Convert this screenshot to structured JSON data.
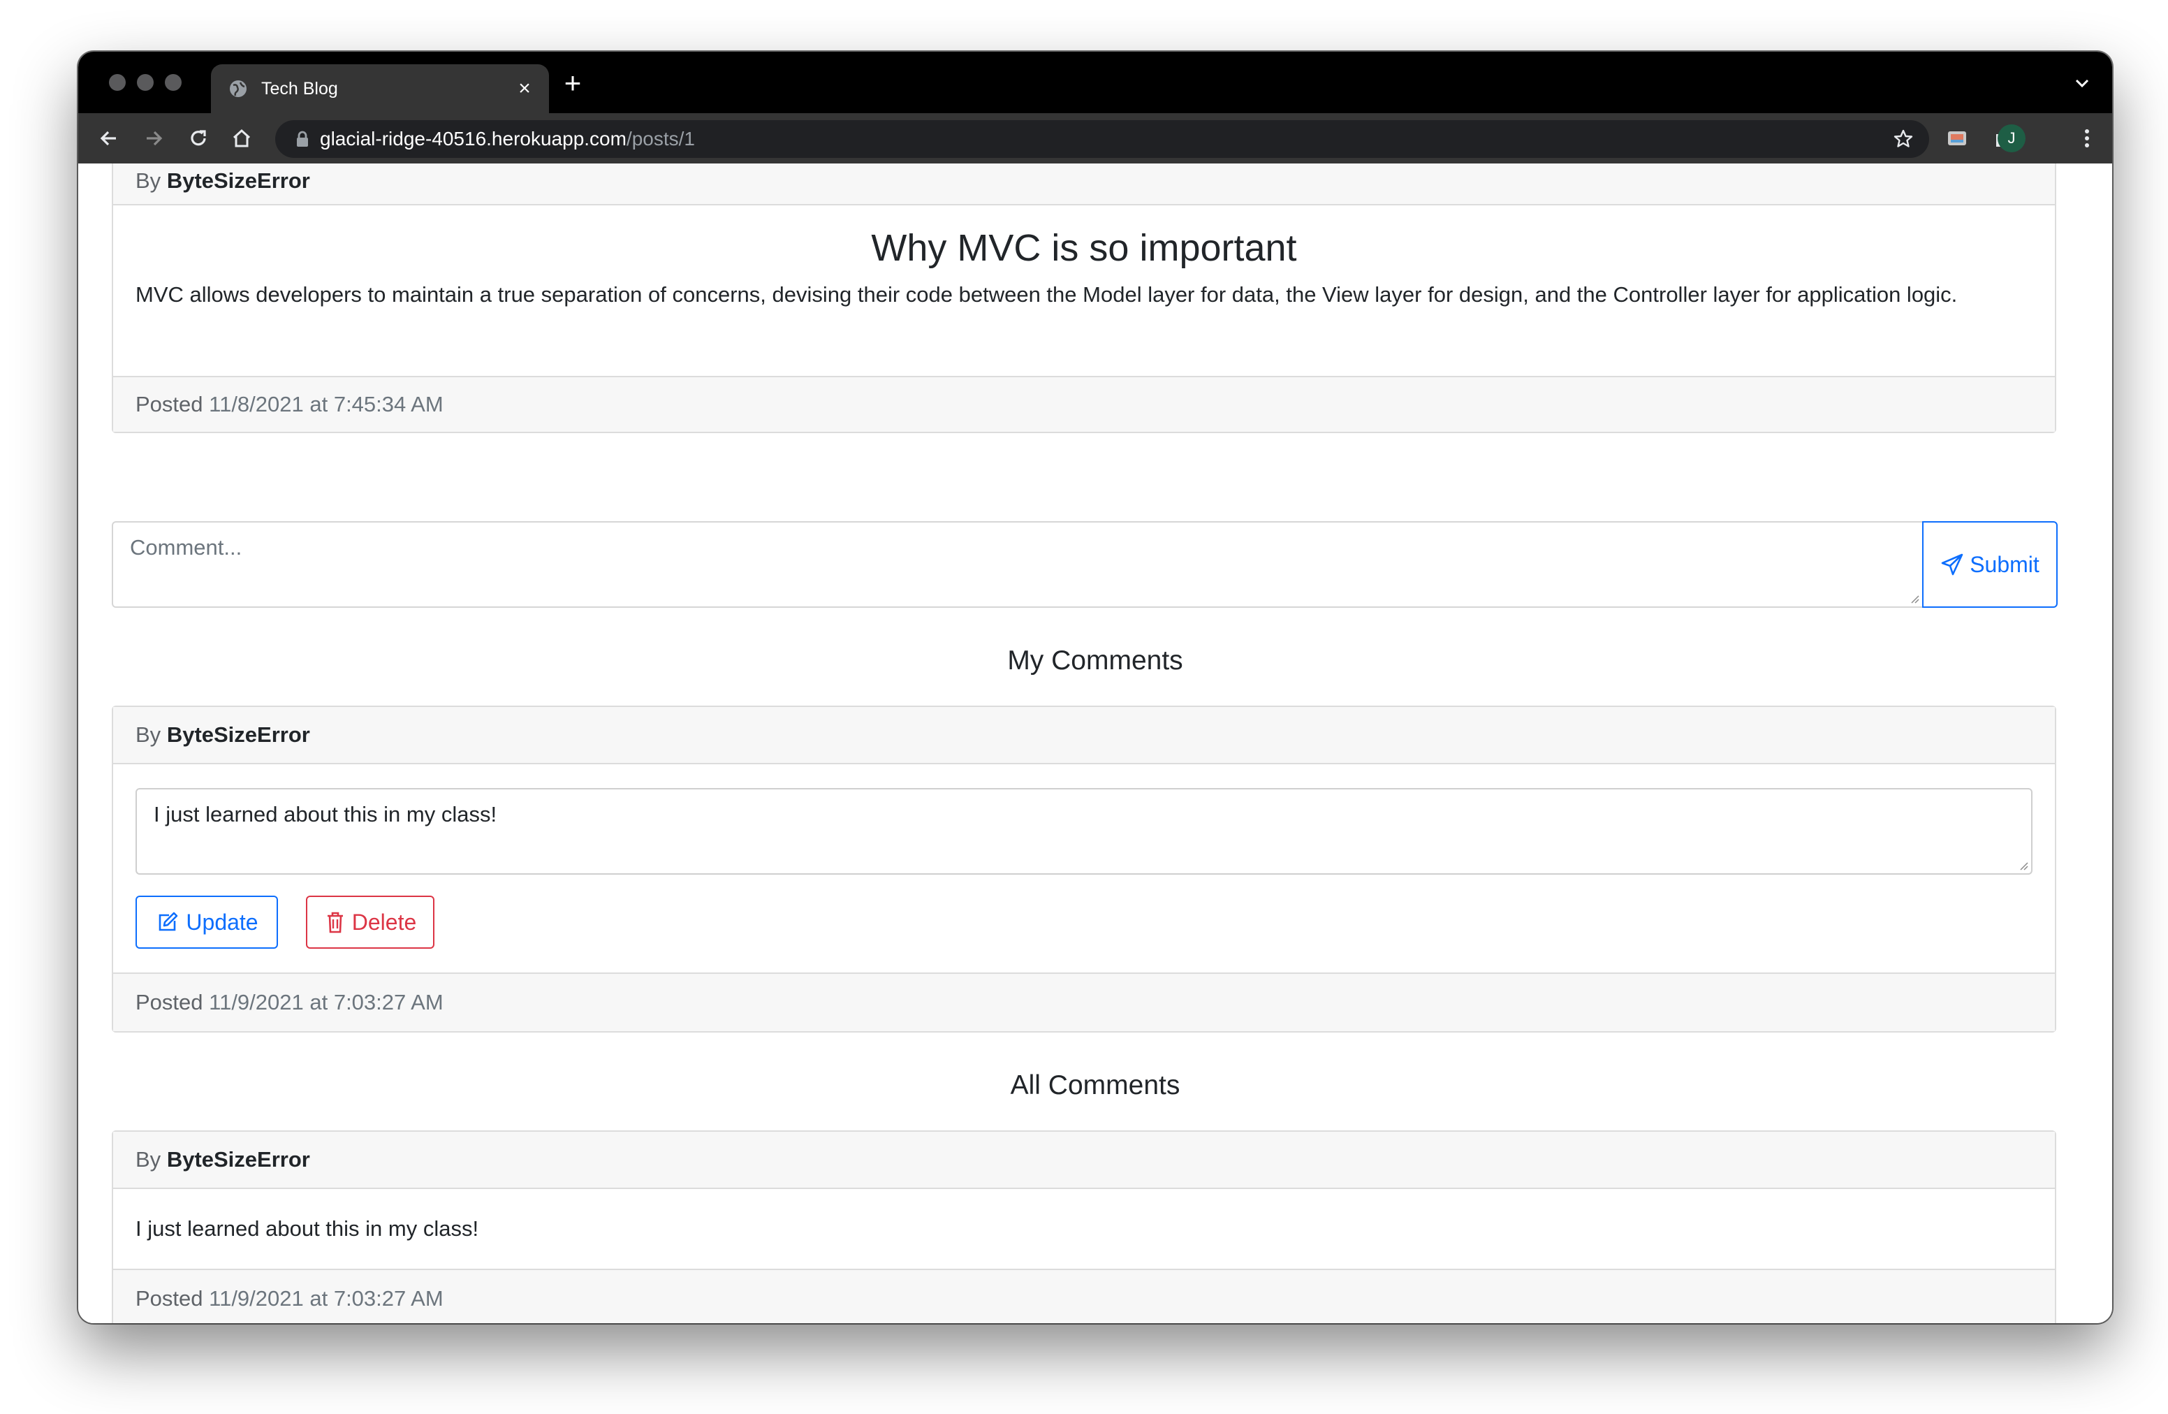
{
  "browser": {
    "tab_title": "Tech Blog",
    "tab_close": "×",
    "new_tab": "+",
    "url_host": "glacial-ridge-40516.herokuapp.com",
    "url_path": "/posts/1",
    "profile_initial": "J"
  },
  "post": {
    "by_label": "By",
    "author": "ByteSizeError",
    "title": "Why MVC is so important",
    "body": "MVC allows developers to maintain a true separation of concerns, devising their code between the Model layer for data, the View layer for design, and the Controller layer for application logic.",
    "posted_label": "Posted",
    "posted_at": "11/8/2021 at 7:45:34 AM"
  },
  "comment_form": {
    "placeholder": "Comment...",
    "submit_label": "Submit"
  },
  "my_comments": {
    "heading": "My Comments",
    "items": [
      {
        "by_label": "By",
        "author": "ByteSizeError",
        "text": "I just learned about this in my class!",
        "update_label": "Update",
        "delete_label": "Delete",
        "posted_label": "Posted",
        "posted_at": "11/9/2021 at 7:03:27 AM"
      }
    ]
  },
  "all_comments": {
    "heading": "All Comments",
    "items": [
      {
        "by_label": "By",
        "author": "ByteSizeError",
        "text": "I just learned about this in my class!",
        "posted_label": "Posted",
        "posted_at": "11/9/2021 at 7:03:27 AM"
      }
    ]
  },
  "colors": {
    "primary": "#0d6efd",
    "danger": "#dc3545",
    "card_header_bg": "#f7f7f7"
  }
}
